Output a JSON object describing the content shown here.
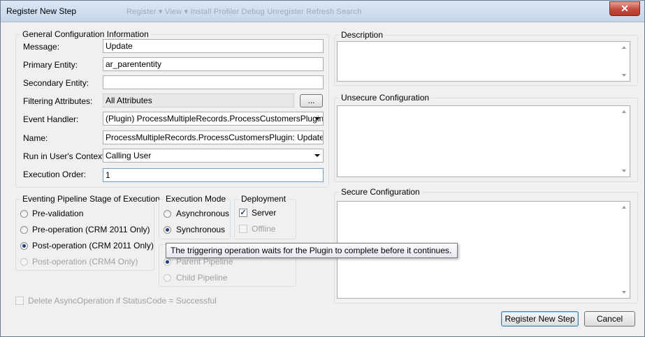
{
  "window": {
    "title": "Register New Step",
    "close_glyph": "✕",
    "background_toolbar": "Register  ▾   View  ▾    Install Profiler    Debug    Unregister    Refresh    Search"
  },
  "general": {
    "legend": "General Configuration Information",
    "message_label": "Message:",
    "message_value": "Update",
    "primary_entity_label": "Primary Entity:",
    "primary_entity_value": "ar_parententity",
    "secondary_entity_label": "Secondary Entity:",
    "secondary_entity_value": "",
    "filtering_label": "Filtering Attributes:",
    "filtering_value": "All Attributes",
    "filtering_button": "...",
    "event_handler_label": "Event Handler:",
    "event_handler_value": "(Plugin) ProcessMultipleRecords.ProcessCustomersPlugin - Iso",
    "name_label": "Name:",
    "name_value": "ProcessMultipleRecords.ProcessCustomersPlugin: Update of ar_p",
    "run_context_label": "Run in User's Context:",
    "run_context_value": "Calling User",
    "exec_order_label": "Execution Order:",
    "exec_order_value": "1"
  },
  "pipeline": {
    "legend": "Eventing Pipeline Stage of Execution",
    "options": [
      {
        "label": "Pre-validation",
        "checked": false,
        "disabled": false
      },
      {
        "label": "Pre-operation (CRM 2011 Only)",
        "checked": false,
        "disabled": false
      },
      {
        "label": "Post-operation (CRM 2011 Only)",
        "checked": true,
        "disabled": false
      },
      {
        "label": "Post-operation (CRM4 Only)",
        "checked": false,
        "disabled": true
      }
    ]
  },
  "execution_mode": {
    "legend": "Execution Mode",
    "options": [
      {
        "label": "Asynchronous",
        "checked": false
      },
      {
        "label": "Synchronous",
        "checked": true
      }
    ]
  },
  "deployment": {
    "legend": "Deployment",
    "server_label": "Server",
    "server_checked": true,
    "offline_label": "Offline",
    "offline_checked": false
  },
  "step_pipeline": {
    "options": [
      {
        "label": "Parent Pipeline",
        "checked": true
      },
      {
        "label": "Child Pipeline",
        "checked": false
      }
    ]
  },
  "tooltip": {
    "text": "The triggering operation waits for the Plugin to complete before it continues."
  },
  "delete_async": {
    "label": "Delete AsyncOperation if StatusCode = Successful",
    "checked": false
  },
  "description": {
    "legend": "Description",
    "value": ""
  },
  "unsecure": {
    "legend": "Unsecure Configuration",
    "value": ""
  },
  "secure": {
    "legend": "Secure Configuration",
    "value": ""
  },
  "buttons": {
    "register": "Register New Step",
    "cancel": "Cancel"
  },
  "colors": {
    "title_gradient_top": "#dbe6f3",
    "close_red": "#c44a3b",
    "window_bg": "#f0f0f0"
  }
}
